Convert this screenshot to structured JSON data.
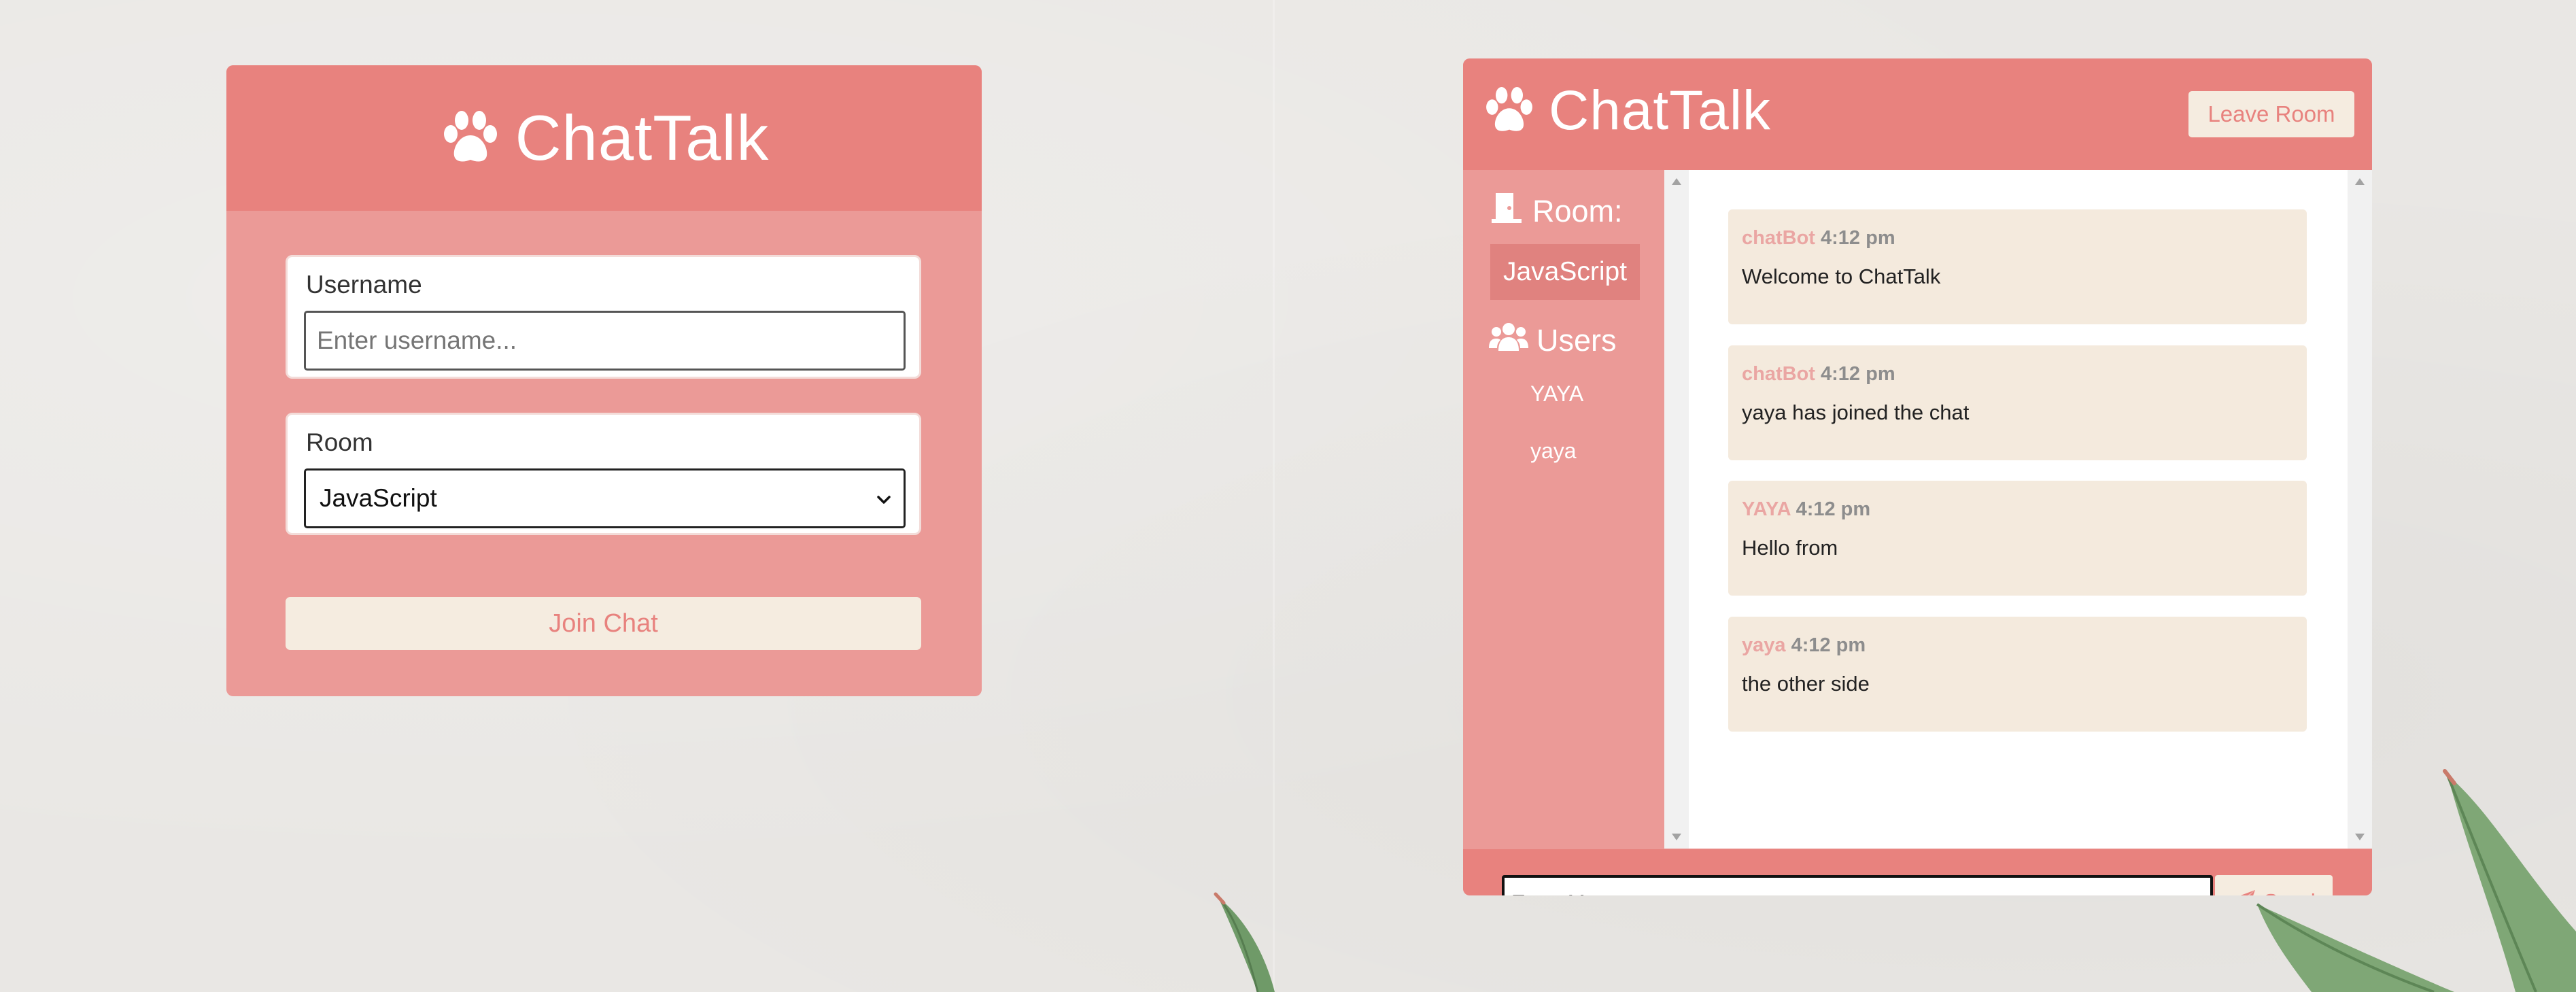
{
  "join_form": {
    "title": "ChatTalk",
    "username_label": "Username",
    "username_placeholder": "Enter username...",
    "room_label": "Room",
    "room_selected": "JavaScript",
    "join_button": "Join Chat"
  },
  "chat": {
    "title": "ChatTalk",
    "leave_button": "Leave Room",
    "room_heading": "Room:",
    "room_name": "JavaScript",
    "users_heading": "Users",
    "users": [
      "YAYA",
      "yaya"
    ],
    "messages": [
      {
        "author": "chatBot",
        "time": "4:12 pm",
        "text": "Welcome to ChatTalk"
      },
      {
        "author": "chatBot",
        "time": "4:12 pm",
        "text": "yaya has joined the chat"
      },
      {
        "author": "YAYA",
        "time": "4:12 pm",
        "text": "Hello from"
      },
      {
        "author": "yaya",
        "time": "4:12 pm",
        "text": "the other side"
      }
    ],
    "input_placeholder": "Enter Message",
    "send_button": "Send"
  },
  "colors": {
    "header": "#e8827e",
    "panel": "#eb9a97",
    "button_bg": "#f5ece0",
    "message_bg": "#f4eadd",
    "background": "#e9e7e4"
  },
  "icons": {
    "brand": "paw-icon",
    "room": "door-icon",
    "users": "users-icon",
    "send": "paper-plane-icon"
  }
}
